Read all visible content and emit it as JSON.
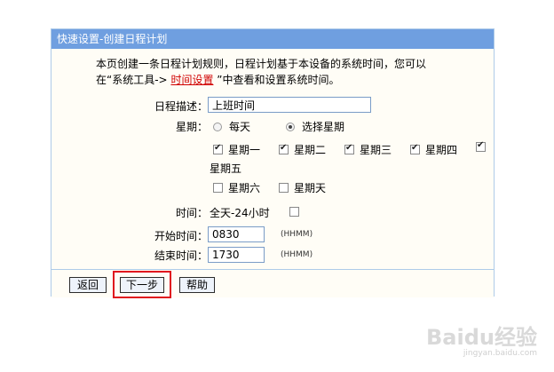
{
  "panel": {
    "title": "快速设置-创建日程计划",
    "intro_line1": "本页创建一条日程计划规则，日程计划基于本设备的系统时间，您可以",
    "intro_line2_prefix": "在“系统工具->",
    "intro_link": "时间设置",
    "intro_line2_suffix": "”中查看和设置系统时间。"
  },
  "form": {
    "desc_label": "日程描述：",
    "desc_value": "上班时间",
    "week_label": "星期：",
    "radio_everyday": "每天",
    "radio_select": "选择星期",
    "days": [
      {
        "label": "星期一",
        "checked": true
      },
      {
        "label": "星期二",
        "checked": true
      },
      {
        "label": "星期三",
        "checked": true
      },
      {
        "label": "星期四",
        "checked": true
      },
      {
        "label": "星期五",
        "checked": true
      },
      {
        "label": "星期六",
        "checked": false
      },
      {
        "label": "星期天",
        "checked": false
      }
    ],
    "time_label": "时间：",
    "allday_label": "全天-24小时",
    "start_label": "开始时间：",
    "start_value": "0830",
    "end_label": "结束时间：",
    "end_value": "1730",
    "hhmm_hint": "(HHMM)"
  },
  "buttons": {
    "back": "返回",
    "next": "下一步",
    "help": "帮助"
  },
  "watermark": {
    "text": "Baidu经验",
    "sub": "jingyan.baidu.com"
  }
}
